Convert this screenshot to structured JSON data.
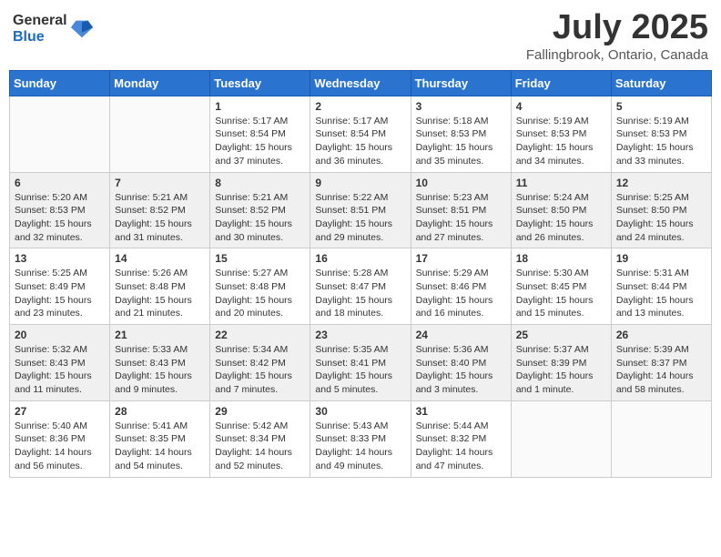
{
  "logo": {
    "general": "General",
    "blue": "Blue"
  },
  "title": {
    "month_year": "July 2025",
    "location": "Fallingbrook, Ontario, Canada"
  },
  "days_of_week": [
    "Sunday",
    "Monday",
    "Tuesday",
    "Wednesday",
    "Thursday",
    "Friday",
    "Saturday"
  ],
  "weeks": [
    [
      {
        "day": "",
        "info": ""
      },
      {
        "day": "",
        "info": ""
      },
      {
        "day": "1",
        "info": "Sunrise: 5:17 AM\nSunset: 8:54 PM\nDaylight: 15 hours and 37 minutes."
      },
      {
        "day": "2",
        "info": "Sunrise: 5:17 AM\nSunset: 8:54 PM\nDaylight: 15 hours and 36 minutes."
      },
      {
        "day": "3",
        "info": "Sunrise: 5:18 AM\nSunset: 8:53 PM\nDaylight: 15 hours and 35 minutes."
      },
      {
        "day": "4",
        "info": "Sunrise: 5:19 AM\nSunset: 8:53 PM\nDaylight: 15 hours and 34 minutes."
      },
      {
        "day": "5",
        "info": "Sunrise: 5:19 AM\nSunset: 8:53 PM\nDaylight: 15 hours and 33 minutes."
      }
    ],
    [
      {
        "day": "6",
        "info": "Sunrise: 5:20 AM\nSunset: 8:53 PM\nDaylight: 15 hours and 32 minutes."
      },
      {
        "day": "7",
        "info": "Sunrise: 5:21 AM\nSunset: 8:52 PM\nDaylight: 15 hours and 31 minutes."
      },
      {
        "day": "8",
        "info": "Sunrise: 5:21 AM\nSunset: 8:52 PM\nDaylight: 15 hours and 30 minutes."
      },
      {
        "day": "9",
        "info": "Sunrise: 5:22 AM\nSunset: 8:51 PM\nDaylight: 15 hours and 29 minutes."
      },
      {
        "day": "10",
        "info": "Sunrise: 5:23 AM\nSunset: 8:51 PM\nDaylight: 15 hours and 27 minutes."
      },
      {
        "day": "11",
        "info": "Sunrise: 5:24 AM\nSunset: 8:50 PM\nDaylight: 15 hours and 26 minutes."
      },
      {
        "day": "12",
        "info": "Sunrise: 5:25 AM\nSunset: 8:50 PM\nDaylight: 15 hours and 24 minutes."
      }
    ],
    [
      {
        "day": "13",
        "info": "Sunrise: 5:25 AM\nSunset: 8:49 PM\nDaylight: 15 hours and 23 minutes."
      },
      {
        "day": "14",
        "info": "Sunrise: 5:26 AM\nSunset: 8:48 PM\nDaylight: 15 hours and 21 minutes."
      },
      {
        "day": "15",
        "info": "Sunrise: 5:27 AM\nSunset: 8:48 PM\nDaylight: 15 hours and 20 minutes."
      },
      {
        "day": "16",
        "info": "Sunrise: 5:28 AM\nSunset: 8:47 PM\nDaylight: 15 hours and 18 minutes."
      },
      {
        "day": "17",
        "info": "Sunrise: 5:29 AM\nSunset: 8:46 PM\nDaylight: 15 hours and 16 minutes."
      },
      {
        "day": "18",
        "info": "Sunrise: 5:30 AM\nSunset: 8:45 PM\nDaylight: 15 hours and 15 minutes."
      },
      {
        "day": "19",
        "info": "Sunrise: 5:31 AM\nSunset: 8:44 PM\nDaylight: 15 hours and 13 minutes."
      }
    ],
    [
      {
        "day": "20",
        "info": "Sunrise: 5:32 AM\nSunset: 8:43 PM\nDaylight: 15 hours and 11 minutes."
      },
      {
        "day": "21",
        "info": "Sunrise: 5:33 AM\nSunset: 8:43 PM\nDaylight: 15 hours and 9 minutes."
      },
      {
        "day": "22",
        "info": "Sunrise: 5:34 AM\nSunset: 8:42 PM\nDaylight: 15 hours and 7 minutes."
      },
      {
        "day": "23",
        "info": "Sunrise: 5:35 AM\nSunset: 8:41 PM\nDaylight: 15 hours and 5 minutes."
      },
      {
        "day": "24",
        "info": "Sunrise: 5:36 AM\nSunset: 8:40 PM\nDaylight: 15 hours and 3 minutes."
      },
      {
        "day": "25",
        "info": "Sunrise: 5:37 AM\nSunset: 8:39 PM\nDaylight: 15 hours and 1 minute."
      },
      {
        "day": "26",
        "info": "Sunrise: 5:39 AM\nSunset: 8:37 PM\nDaylight: 14 hours and 58 minutes."
      }
    ],
    [
      {
        "day": "27",
        "info": "Sunrise: 5:40 AM\nSunset: 8:36 PM\nDaylight: 14 hours and 56 minutes."
      },
      {
        "day": "28",
        "info": "Sunrise: 5:41 AM\nSunset: 8:35 PM\nDaylight: 14 hours and 54 minutes."
      },
      {
        "day": "29",
        "info": "Sunrise: 5:42 AM\nSunset: 8:34 PM\nDaylight: 14 hours and 52 minutes."
      },
      {
        "day": "30",
        "info": "Sunrise: 5:43 AM\nSunset: 8:33 PM\nDaylight: 14 hours and 49 minutes."
      },
      {
        "day": "31",
        "info": "Sunrise: 5:44 AM\nSunset: 8:32 PM\nDaylight: 14 hours and 47 minutes."
      },
      {
        "day": "",
        "info": ""
      },
      {
        "day": "",
        "info": ""
      }
    ]
  ]
}
